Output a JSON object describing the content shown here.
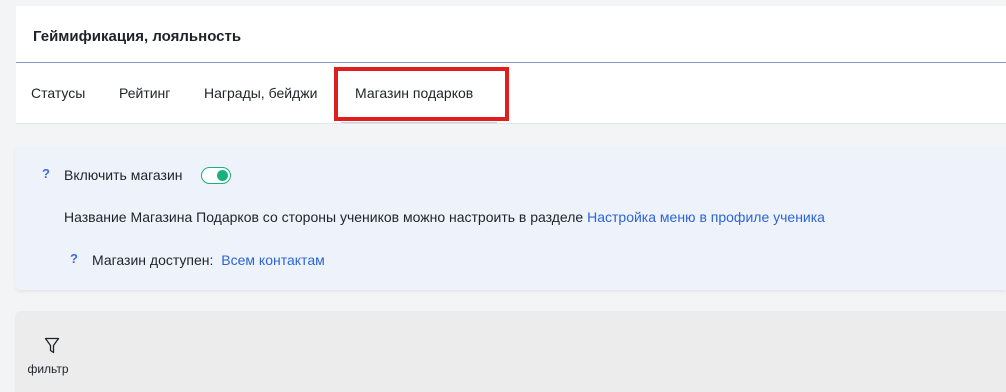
{
  "page": {
    "title": "Геймификация, лояльность"
  },
  "tabs": [
    {
      "label": "Статусы"
    },
    {
      "label": "Рейтинг"
    },
    {
      "label": "Награды, бейджи"
    },
    {
      "label": "Магазин подарков",
      "active": true
    }
  ],
  "settings": {
    "enable_shop": {
      "help": "?",
      "label": "Включить магазин",
      "enabled": true
    },
    "shop_name_hint": {
      "text": "Название Магазина Подарков со стороны учеников можно настроить в разделе",
      "link": "Настройка меню в профиле ученика"
    },
    "availability": {
      "help": "?",
      "label": "Магазин доступен:",
      "value": "Всем контактам"
    }
  },
  "filter": {
    "icon": "filter-icon",
    "label": "фильтр"
  },
  "colors": {
    "accent": "#2c64d6",
    "toggle_on": "#18b07e",
    "highlight": "#e01e1e",
    "settings_bg": "#eef3fb"
  }
}
